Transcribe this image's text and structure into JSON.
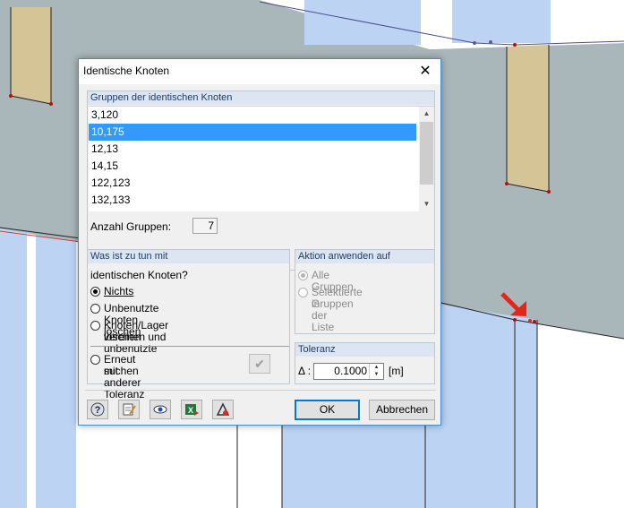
{
  "dialog": {
    "title": "Identische Knoten",
    "close_glyph": "✕"
  },
  "groups": {
    "header": "Gruppen der identischen Knoten",
    "items": [
      "3,120",
      "10,175",
      "12,13",
      "14,15",
      "122,123",
      "132,133"
    ],
    "selected_index": 1,
    "count_label": "Anzahl Gruppen:",
    "count_value": "7"
  },
  "action": {
    "header": "Was ist zu tun mit",
    "question": "identischen Knoten?",
    "options": [
      {
        "label": "Nichts",
        "checked": true
      },
      {
        "label": "Unbenutzte Knoten löschen",
        "checked": false
      },
      {
        "label_line1": "Knoten/Lager vereinen und unbenutzte",
        "label_line2": "löschen",
        "checked": false
      }
    ],
    "retry_line1": "Erneut mit anderer Toleranz",
    "retry_line2": "suchen",
    "retry_checked": false
  },
  "apply": {
    "header": "Aktion anwenden auf",
    "all_groups": "Alle Gruppen",
    "selected_line1": "Selektierte Gruppen",
    "selected_line2": "in der Liste"
  },
  "tolerance": {
    "header": "Toleranz",
    "symbol": "Δ :",
    "value": "0.1000",
    "unit": "[m]"
  },
  "footer": {
    "tools": [
      "help-icon",
      "edit-icon",
      "view-icon",
      "excel-export-icon",
      "nodes-icon"
    ],
    "ok": "OK",
    "cancel": "Abbrechen"
  },
  "colors": {
    "accent": "#3399ff",
    "header_bg": "#dce6f2",
    "header_text": "#1f3b68",
    "highlight_arrow": "#e2261b"
  }
}
